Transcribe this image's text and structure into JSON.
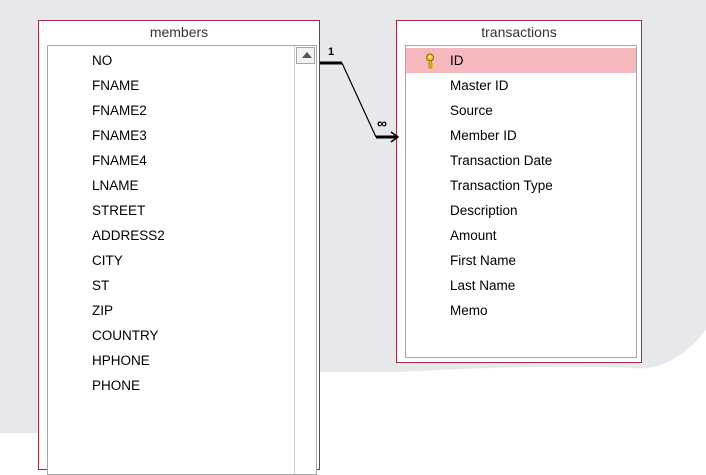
{
  "members": {
    "title": "members",
    "fields": [
      "NO",
      "FNAME",
      "FNAME2",
      "FNAME3",
      "FNAME4",
      "LNAME",
      "STREET",
      "ADDRESS2",
      "CITY",
      "ST",
      "ZIP",
      "COUNTRY",
      "HPHONE",
      "PHONE"
    ]
  },
  "transactions": {
    "title": "transactions",
    "fields": [
      "ID",
      "Master ID",
      "Source",
      "Member ID",
      "Transaction Date",
      "Transaction Type",
      "Description",
      "Amount",
      "First Name",
      "Last Name",
      "Memo"
    ],
    "primary_key": "ID"
  },
  "relationship": {
    "one_label": "1",
    "many_label": "∞"
  },
  "colors": {
    "table_border": "#9b2d3c",
    "selected_row": "#f4b8bd",
    "canvas_gray": "#e6e8ec"
  },
  "icons": {
    "primary_key": "key-icon",
    "scroll_up": "arrow-up-icon"
  }
}
